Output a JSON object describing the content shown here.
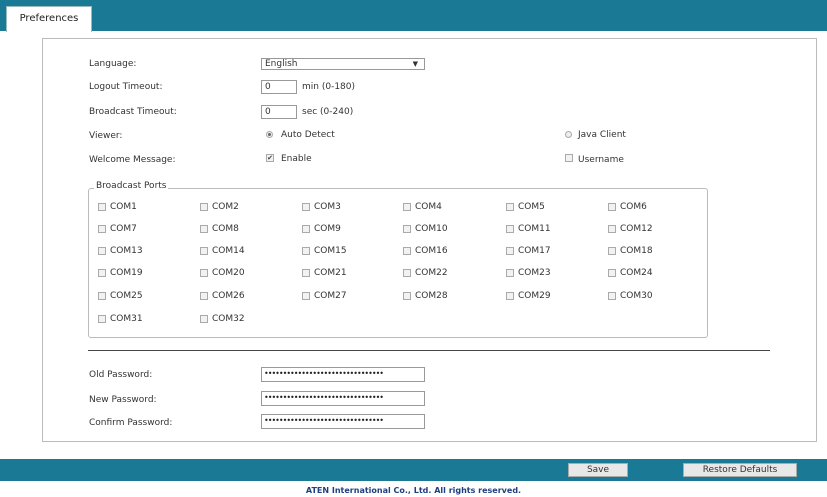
{
  "tab": {
    "label": "Preferences"
  },
  "language": {
    "label": "Language:",
    "value": "English"
  },
  "logout_timeout": {
    "label": "Logout Timeout:",
    "value": "0",
    "unit": "min (0-180)"
  },
  "broadcast_timeout": {
    "label": "Broadcast Timeout:",
    "value": "0",
    "unit": "sec (0-240)"
  },
  "viewer": {
    "label": "Viewer:",
    "option_auto": "Auto Detect",
    "option_java": "Java Client",
    "selected": "Auto Detect"
  },
  "welcome_message": {
    "label": "Welcome Message:",
    "enable": "Enable",
    "enable_checked": true,
    "username": "Username",
    "username_checked": false
  },
  "broadcast_ports": {
    "legend": "Broadcast Ports",
    "ports": [
      "COM1",
      "COM2",
      "COM3",
      "COM4",
      "COM5",
      "COM6",
      "COM7",
      "COM8",
      "COM9",
      "COM10",
      "COM11",
      "COM12",
      "COM13",
      "COM14",
      "COM15",
      "COM16",
      "COM17",
      "COM18",
      "COM19",
      "COM20",
      "COM21",
      "COM22",
      "COM23",
      "COM24",
      "COM25",
      "COM26",
      "COM27",
      "COM28",
      "COM29",
      "COM30",
      "COM31",
      "COM32"
    ]
  },
  "old_password": {
    "label": "Old Password:",
    "value": "••••••••••••••••••••••••••••••••"
  },
  "new_password": {
    "label": "New Password:",
    "value": "••••••••••••••••••••••••••••••••"
  },
  "confirm_password": {
    "label": "Confirm Password:",
    "value": "••••••••••••••••••••••••••••••••"
  },
  "buttons": {
    "save": "Save",
    "restore": "Restore Defaults"
  },
  "footer": "ATEN International Co., Ltd. All rights reserved.",
  "colors": {
    "bar": "#1a7a96",
    "footer_text": "#1f3f80"
  }
}
